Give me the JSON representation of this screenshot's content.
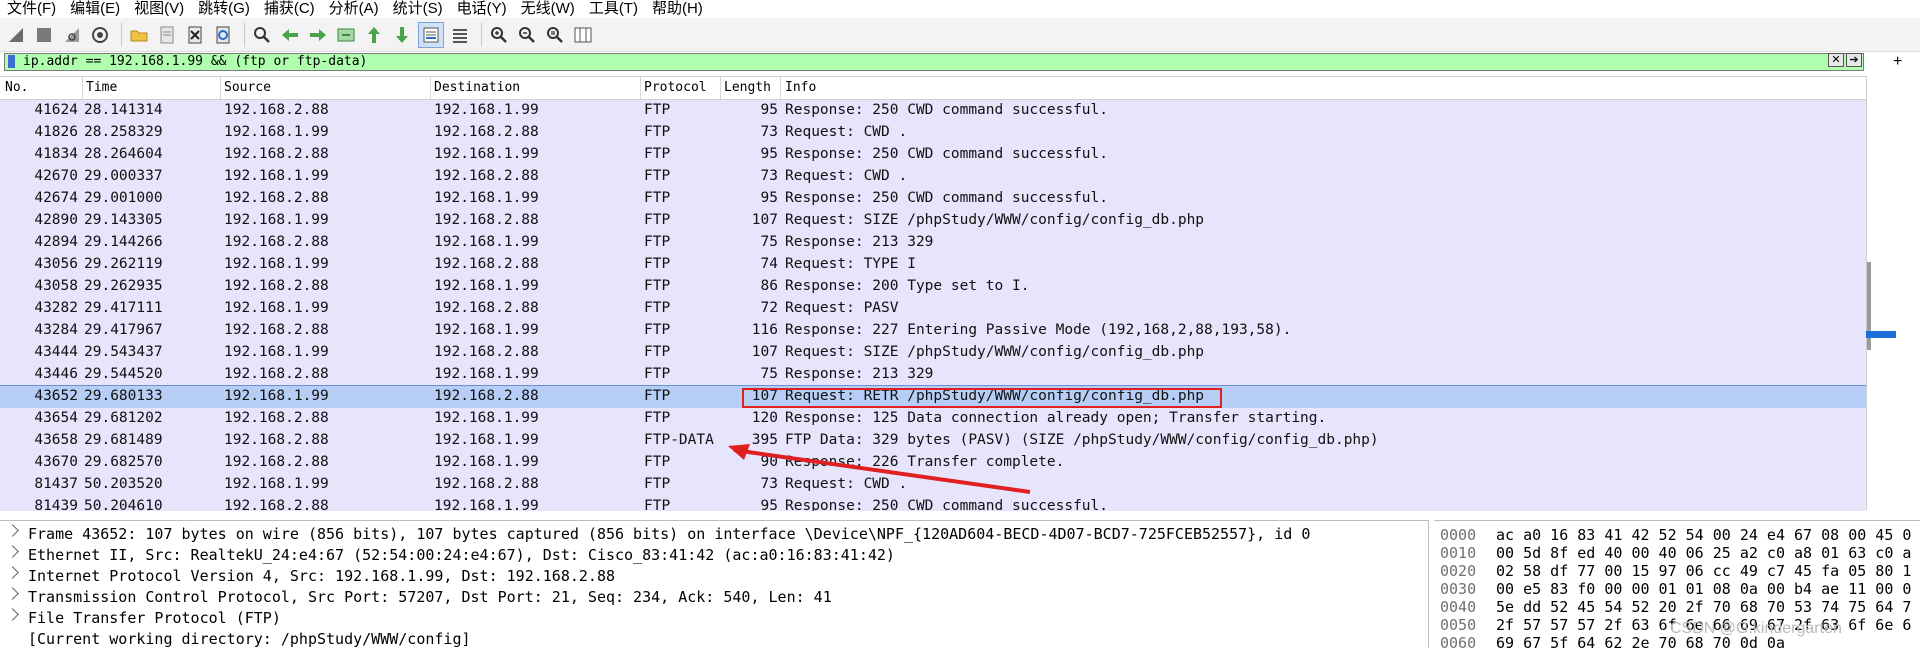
{
  "menu": [
    "文件(F)",
    "编辑(E)",
    "视图(V)",
    "跳转(G)",
    "捕获(C)",
    "分析(A)",
    "统计(S)",
    "电话(Y)",
    "无线(W)",
    "工具(T)",
    "帮助(H)"
  ],
  "toolbar": {
    "icons": [
      "shark-fin-start-icon",
      "stop-capture-icon",
      "restart-capture-icon",
      "capture-options-icon",
      "open-file-icon",
      "save-file-icon",
      "close-file-icon",
      "reload-icon",
      "find-packet-icon",
      "go-back-icon",
      "go-forward-icon",
      "go-to-packet-icon",
      "first-packet-icon",
      "last-packet-icon",
      "autoscroll-icon",
      "colorize-icon",
      "zoom-in-icon",
      "zoom-out-icon",
      "normal-size-icon",
      "resize-columns-icon"
    ]
  },
  "filter": {
    "value": "ip.addr == 192.168.1.99 && (ftp or ftp-data)",
    "plus": "+"
  },
  "packet_list": {
    "columns": [
      "No.",
      "Time",
      "Source",
      "Destination",
      "Protocol",
      "Length",
      "Info"
    ],
    "rows": [
      {
        "no": "41624",
        "time": "28.141314",
        "src": "192.168.2.88",
        "dst": "192.168.1.99",
        "proto": "FTP",
        "len": "95",
        "info": "Response: 250 CWD command successful."
      },
      {
        "no": "41826",
        "time": "28.258329",
        "src": "192.168.1.99",
        "dst": "192.168.2.88",
        "proto": "FTP",
        "len": "73",
        "info": "Request: CWD ."
      },
      {
        "no": "41834",
        "time": "28.264604",
        "src": "192.168.2.88",
        "dst": "192.168.1.99",
        "proto": "FTP",
        "len": "95",
        "info": "Response: 250 CWD command successful."
      },
      {
        "no": "42670",
        "time": "29.000337",
        "src": "192.168.1.99",
        "dst": "192.168.2.88",
        "proto": "FTP",
        "len": "73",
        "info": "Request: CWD ."
      },
      {
        "no": "42674",
        "time": "29.001000",
        "src": "192.168.2.88",
        "dst": "192.168.1.99",
        "proto": "FTP",
        "len": "95",
        "info": "Response: 250 CWD command successful."
      },
      {
        "no": "42890",
        "time": "29.143305",
        "src": "192.168.1.99",
        "dst": "192.168.2.88",
        "proto": "FTP",
        "len": "107",
        "info": "Request: SIZE /phpStudy/WWW/config/config_db.php"
      },
      {
        "no": "42894",
        "time": "29.144266",
        "src": "192.168.2.88",
        "dst": "192.168.1.99",
        "proto": "FTP",
        "len": "75",
        "info": "Response: 213 329"
      },
      {
        "no": "43056",
        "time": "29.262119",
        "src": "192.168.1.99",
        "dst": "192.168.2.88",
        "proto": "FTP",
        "len": "74",
        "info": "Request: TYPE I"
      },
      {
        "no": "43058",
        "time": "29.262935",
        "src": "192.168.2.88",
        "dst": "192.168.1.99",
        "proto": "FTP",
        "len": "86",
        "info": "Response: 200 Type set to I."
      },
      {
        "no": "43282",
        "time": "29.417111",
        "src": "192.168.1.99",
        "dst": "192.168.2.88",
        "proto": "FTP",
        "len": "72",
        "info": "Request: PASV"
      },
      {
        "no": "43284",
        "time": "29.417967",
        "src": "192.168.2.88",
        "dst": "192.168.1.99",
        "proto": "FTP",
        "len": "116",
        "info": "Response: 227 Entering Passive Mode (192,168,2,88,193,58)."
      },
      {
        "no": "43444",
        "time": "29.543437",
        "src": "192.168.1.99",
        "dst": "192.168.2.88",
        "proto": "FTP",
        "len": "107",
        "info": "Request: SIZE /phpStudy/WWW/config/config_db.php"
      },
      {
        "no": "43446",
        "time": "29.544520",
        "src": "192.168.2.88",
        "dst": "192.168.1.99",
        "proto": "FTP",
        "len": "75",
        "info": "Response: 213 329"
      },
      {
        "no": "43652",
        "time": "29.680133",
        "src": "192.168.1.99",
        "dst": "192.168.2.88",
        "proto": "FTP",
        "len": "107",
        "info": "Request: RETR /phpStudy/WWW/config/config_db.php"
      },
      {
        "no": "43654",
        "time": "29.681202",
        "src": "192.168.2.88",
        "dst": "192.168.1.99",
        "proto": "FTP",
        "len": "120",
        "info": "Response: 125 Data connection already open; Transfer starting."
      },
      {
        "no": "43658",
        "time": "29.681489",
        "src": "192.168.2.88",
        "dst": "192.168.1.99",
        "proto": "FTP-DATA",
        "len": "395",
        "info": "FTP Data: 329 bytes (PASV) (SIZE /phpStudy/WWW/config/config_db.php)"
      },
      {
        "no": "43670",
        "time": "29.682570",
        "src": "192.168.2.88",
        "dst": "192.168.1.99",
        "proto": "FTP",
        "len": "90",
        "info": "Response: 226 Transfer complete."
      },
      {
        "no": "81437",
        "time": "50.203520",
        "src": "192.168.1.99",
        "dst": "192.168.2.88",
        "proto": "FTP",
        "len": "73",
        "info": "Request: CWD ."
      },
      {
        "no": "81439",
        "time": "50.204610",
        "src": "192.168.2.88",
        "dst": "192.168.1.99",
        "proto": "FTP",
        "len": "95",
        "info": "Response: 250 CWD command successful."
      }
    ],
    "selected_no": "43652"
  },
  "details": [
    "Frame 43652: 107 bytes on wire (856 bits), 107 bytes captured (856 bits) on interface \\Device\\NPF_{120AD604-BECD-4D07-BCD7-725FCEB52557}, id 0",
    "Ethernet II, Src: RealtekU_24:e4:67 (52:54:00:24:e4:67), Dst: Cisco_83:41:42 (ac:a0:16:83:41:42)",
    "Internet Protocol Version 4, Src: 192.168.1.99, Dst: 192.168.2.88",
    "Transmission Control Protocol, Src Port: 57207, Dst Port: 21, Seq: 234, Ack: 540, Len: 41",
    "File Transfer Protocol (FTP)",
    "[Current working directory: /phpStudy/WWW/config]"
  ],
  "hex": [
    {
      "off": "0000",
      "bytes": "ac a0 16 83 41 42 52 54  00 24 e4 67 08 00 45 0"
    },
    {
      "off": "0010",
      "bytes": "00 5d 8f ed 40 00 40 06  25 a2 c0 a8 01 63 c0 a"
    },
    {
      "off": "0020",
      "bytes": "02 58 df 77 00 15 97 06  cc 49 c7 45 fa 05 80 1"
    },
    {
      "off": "0030",
      "bytes": "00 e5 83 f0 00 00 01 01  08 0a 00 b4 ae 11 00 0"
    },
    {
      "off": "0040",
      "bytes": "5e dd 52 45 54 52 20 2f  70 68 70 53 74 75 64 7"
    },
    {
      "off": "0050",
      "bytes": "2f 57 57 57 2f 63 6f 6e  66 69 67 2f 63 6f 6e 6"
    },
    {
      "off": "0060",
      "bytes": "69 67 5f 64 62 2e 70 68  70 0d 0a"
    }
  ],
  "watermark": "CSDN @G.kindergarten",
  "colors": {
    "row_bg": "#e6e5fc",
    "selected_row": "#b6cdf5",
    "filter_bg": "#afffaf",
    "annotation_red": "#e02020"
  }
}
